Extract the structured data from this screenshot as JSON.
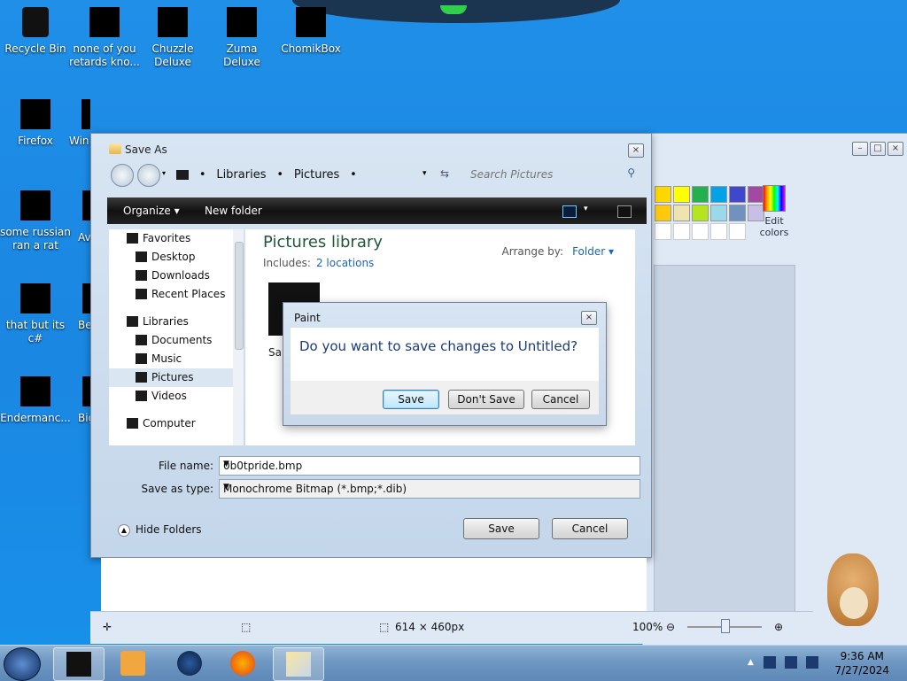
{
  "desktop": {
    "icons": [
      {
        "label": "Recycle Bin"
      },
      {
        "label": "none of you retards kno..."
      },
      {
        "label": "Chuzzle Deluxe"
      },
      {
        "label": "Zuma Deluxe"
      },
      {
        "label": "ChomikBox"
      },
      {
        "label": "Firefox"
      },
      {
        "label": "Win"
      },
      {
        "label": "some russian ran a rat"
      },
      {
        "label": "Av"
      },
      {
        "label": "that but its c#"
      },
      {
        "label": "Be"
      },
      {
        "label": "Endermanc..."
      },
      {
        "label": "Big"
      }
    ]
  },
  "save_as": {
    "title": "Save As",
    "breadcrumbs": [
      "Libraries",
      "Pictures"
    ],
    "search_placeholder": "Search Pictures",
    "toolbar": {
      "organize": "Organize ▾",
      "new_folder": "New folder"
    },
    "nav": [
      {
        "label": "Favorites",
        "type": "hdr"
      },
      {
        "label": "Desktop",
        "type": "child"
      },
      {
        "label": "Downloads",
        "type": "child"
      },
      {
        "label": "Recent Places",
        "type": "child"
      },
      {
        "label": "Libraries",
        "type": "hdr"
      },
      {
        "label": "Documents",
        "type": "child"
      },
      {
        "label": "Music",
        "type": "child"
      },
      {
        "label": "Pictures",
        "type": "child",
        "selected": true
      },
      {
        "label": "Videos",
        "type": "child"
      },
      {
        "label": "Computer",
        "type": "hdr"
      }
    ],
    "library_title": "Pictures library",
    "includes_label": "Includes:",
    "includes_link": "2 locations",
    "arrange_label": "Arrange by:",
    "arrange_value": "Folder ▾",
    "folder_item": "Sar",
    "file_name_label": "File name:",
    "file_name_value": "0b0tpride.bmp",
    "save_type_label": "Save as type:",
    "save_type_value": "Monochrome Bitmap (*.bmp;*.dib)",
    "hide_folders": "Hide Folders",
    "save_button": "Save",
    "cancel_button": "Cancel"
  },
  "paint_prompt": {
    "title": "Paint",
    "message": "Do you want to save changes to Untitled?",
    "save": "Save",
    "dont_save": "Don't Save",
    "cancel": "Cancel"
  },
  "paint": {
    "edit_colors": "Edit colors",
    "palette_row1": [
      "#ffd800",
      "#ffff00",
      "#22b14c",
      "#00a2e8",
      "#3f48cc",
      "#a349a4"
    ],
    "palette_row2": [
      "#ffc90e",
      "#efe4b0",
      "#b5e61d",
      "#99d9ea",
      "#7092be",
      "#c8bfe7"
    ],
    "canvas_size": "614 × 460px",
    "zoom": "100%"
  },
  "taskbar": {
    "time": "9:36 AM",
    "date": "7/27/2024"
  }
}
